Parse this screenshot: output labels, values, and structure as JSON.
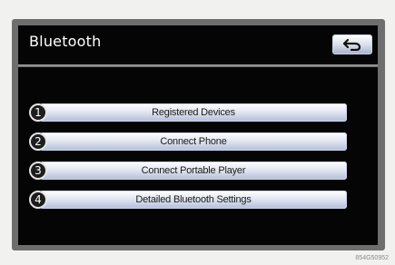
{
  "screen": {
    "title": "Bluetooth",
    "back_icon": "back-arrow-icon"
  },
  "menu": {
    "items": [
      {
        "number": "1",
        "label": "Registered Devices"
      },
      {
        "number": "2",
        "label": "Connect Phone"
      },
      {
        "number": "3",
        "label": "Connect Portable Player"
      },
      {
        "number": "4",
        "label": "Detailed Bluetooth Settings"
      }
    ]
  },
  "figure_code": "854G50952",
  "colors": {
    "screen_bg": "#050505",
    "button_top": "#ffffff",
    "button_bottom": "#b3bdd8",
    "page_bg": "#f1f1ef"
  }
}
